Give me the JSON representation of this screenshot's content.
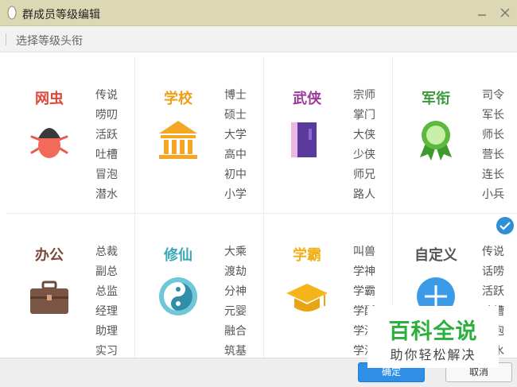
{
  "window": {
    "title": "群成员等级编辑",
    "minimize_icon": "minimize-icon",
    "close_icon": "close-icon",
    "app_icon": "qq-penguin-icon"
  },
  "toolbar": {
    "label": "选择等级头衔"
  },
  "colors": {
    "titlebar": "#dcd8b4",
    "accent_blue": "#2f8ee6",
    "wangchong": "#e0453a",
    "xuexiao": "#ef9e1a",
    "wuxia": "#9b3a9a",
    "junxian": "#3d9a3c",
    "bangong": "#7a4a3a",
    "xiuxian": "#3aa6b8",
    "xueba": "#f0b01a",
    "zidingyi": "#555555"
  },
  "categories": [
    {
      "title": "网虫",
      "icon": "bug-icon",
      "ranks": [
        "传说",
        "唠叨",
        "活跃",
        "吐槽",
        "冒泡",
        "潜水"
      ]
    },
    {
      "title": "学校",
      "icon": "school-building-icon",
      "ranks": [
        "博士",
        "硕士",
        "大学",
        "高中",
        "初中",
        "小学"
      ]
    },
    {
      "title": "武侠",
      "icon": "martial-arts-book-icon",
      "ranks": [
        "宗师",
        "掌门",
        "大侠",
        "少侠",
        "师兄",
        "路人"
      ]
    },
    {
      "title": "军衔",
      "icon": "medal-icon",
      "ranks": [
        "司令",
        "军长",
        "师长",
        "营长",
        "连长",
        "小兵"
      ]
    },
    {
      "title": "办公",
      "icon": "briefcase-icon",
      "ranks": [
        "总裁",
        "副总",
        "总监",
        "经理",
        "助理",
        "实习"
      ]
    },
    {
      "title": "修仙",
      "icon": "yin-yang-icon",
      "ranks": [
        "大乘",
        "渡劫",
        "分神",
        "元婴",
        "融合",
        "筑基"
      ]
    },
    {
      "title": "学霸",
      "icon": "graduation-cap-icon",
      "ranks": [
        "叫兽",
        "学神",
        "学霸",
        "学酥",
        "学渣",
        "学沫"
      ]
    },
    {
      "title": "自定义",
      "icon": "plus-circle-icon",
      "ranks": [
        "传说",
        "话唠",
        "活跃",
        "吐槽",
        "冒泡",
        "潜水"
      ]
    }
  ],
  "selected_badge": "check-circle-icon",
  "watermark": {
    "line1": "百科全说",
    "line2": "助你轻松解决"
  },
  "footer": {
    "ok_label": "确定",
    "cancel_label": "取消"
  }
}
